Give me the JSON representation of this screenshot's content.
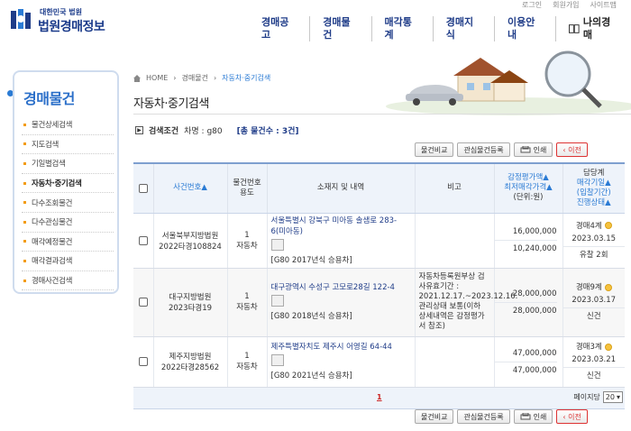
{
  "util_links": [
    "로그인",
    "회원가입",
    "사이트맵"
  ],
  "logo": {
    "small": "대한민국 법원",
    "big": "법원경매정보"
  },
  "gnb": [
    "경매공고",
    "경매물건",
    "매각통계",
    "경매지식",
    "이용안내",
    "나의경매"
  ],
  "sidebar": {
    "title": "경매물건",
    "items": [
      {
        "label": "물건상세검색",
        "active": false
      },
      {
        "label": "지도검색",
        "active": false
      },
      {
        "label": "기일별검색",
        "active": false
      },
      {
        "label": "자동차·중기검색",
        "active": true
      },
      {
        "label": "다수조회물건",
        "active": false
      },
      {
        "label": "다수관심물건",
        "active": false
      },
      {
        "label": "매각예정물건",
        "active": false
      },
      {
        "label": "매각결과검색",
        "active": false
      },
      {
        "label": "경매사건검색",
        "active": false
      }
    ]
  },
  "breadcrumb": [
    "HOME",
    "경매물건",
    "자동차·중기검색"
  ],
  "page_title": "자동차·중기검색",
  "search_cond": {
    "label": "검색조건",
    "detail": "차명 : g80",
    "total": "[총 물건수 : 3건]"
  },
  "buttons": {
    "compare": "물건비교",
    "interest": "관심물건등록",
    "print": "인쇄",
    "back": "이전"
  },
  "table": {
    "headers": {
      "case_no": "사건번호▲",
      "item_no": "물건번호\n용도",
      "location": "소재지 및 내역",
      "remark": "비고",
      "price_a": "감정평가액▲",
      "price_b": "최저매각가격▲",
      "price_unit": "(단위:원)",
      "stage_a": "담당계",
      "stage_b": "매각기일▲",
      "stage_c": "(입찰기간)",
      "stage_d": "진행상태▲"
    },
    "rows": [
      {
        "court": "서울북부지방법원",
        "case": "2022타경108824",
        "item_no": "1",
        "use": "자동차",
        "loc": "서울특별시 강북구 미아동 솔샘로 283-6(미아동)",
        "spec": "[G80 2017년식 승용차]",
        "remark": "",
        "appraisal": "16,000,000",
        "minimum": "10,240,000",
        "dept": "경매4계",
        "date": "2023.03.15",
        "status": "유찰 2회"
      },
      {
        "court": "대구지방법원",
        "case": "2023타경19",
        "item_no": "1",
        "use": "자동차",
        "loc": "대구광역시 수성구 고모로28길 122-4",
        "spec": "[G80 2018년식 승용차]",
        "remark": "자동차등록원부상 검사유효기간 : 2021.12.17.~2023.12.16. 관리상태 보통(이하 상세내역은 감정평가서 참조)",
        "appraisal": "28,000,000",
        "minimum": "28,000,000",
        "dept": "경매9계",
        "date": "2023.03.17",
        "status": "신건"
      },
      {
        "court": "제주지방법원",
        "case": "2022타경28562",
        "item_no": "1",
        "use": "자동차",
        "loc": "제주특별자치도 제주시 어영길 64-44",
        "spec": "[G80 2021년식 승용차]",
        "remark": "",
        "appraisal": "47,000,000",
        "minimum": "47,000,000",
        "dept": "경매3계",
        "date": "2023.03.21",
        "status": "신건"
      }
    ]
  },
  "pager": {
    "current": "1",
    "per_page_label": "페이지당",
    "per_page": "20"
  },
  "colors": {
    "brand": "#1f3c88",
    "accent": "#2b7bd4",
    "back": "#dd3333",
    "coin": "#f6c23e"
  }
}
